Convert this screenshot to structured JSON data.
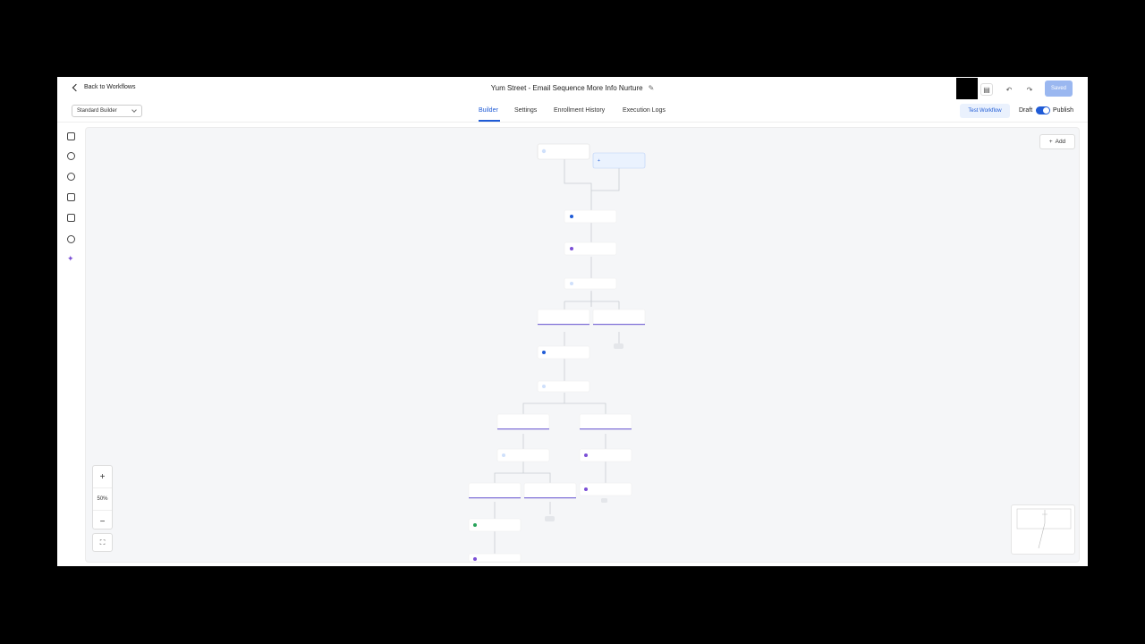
{
  "header": {
    "back_label": "Back to Workflows",
    "title": "Yum Street - Email Sequence More Info Nurture",
    "saved_label": "Saved"
  },
  "tabs": {
    "builder_select": "Standard Builder",
    "items": [
      "Builder",
      "Settings",
      "Enrollment History",
      "Execution Logs"
    ],
    "active": "Builder",
    "test_label": "Test Workflow",
    "draft_label": "Draft",
    "publish_label": "Publish"
  },
  "canvas": {
    "add_label": "Add",
    "zoom_level": "50%",
    "zoom_in": "+",
    "zoom_out": "−"
  },
  "icons": {
    "back": "chevron-left-icon",
    "edit": "pencil-icon",
    "save": "save-icon",
    "undo": "undo-icon",
    "redo": "redo-icon",
    "left_sidebar": [
      "chat-icon",
      "check-circle-icon",
      "clock-icon",
      "document-icon",
      "external-link-icon",
      "history-icon",
      "sparkle-icon"
    ],
    "fit": "fit-screen-icon"
  },
  "colors": {
    "accent": "#1f5bd6",
    "saved_button": "#9ab7f0",
    "canvas_bg": "#f5f6f8"
  }
}
